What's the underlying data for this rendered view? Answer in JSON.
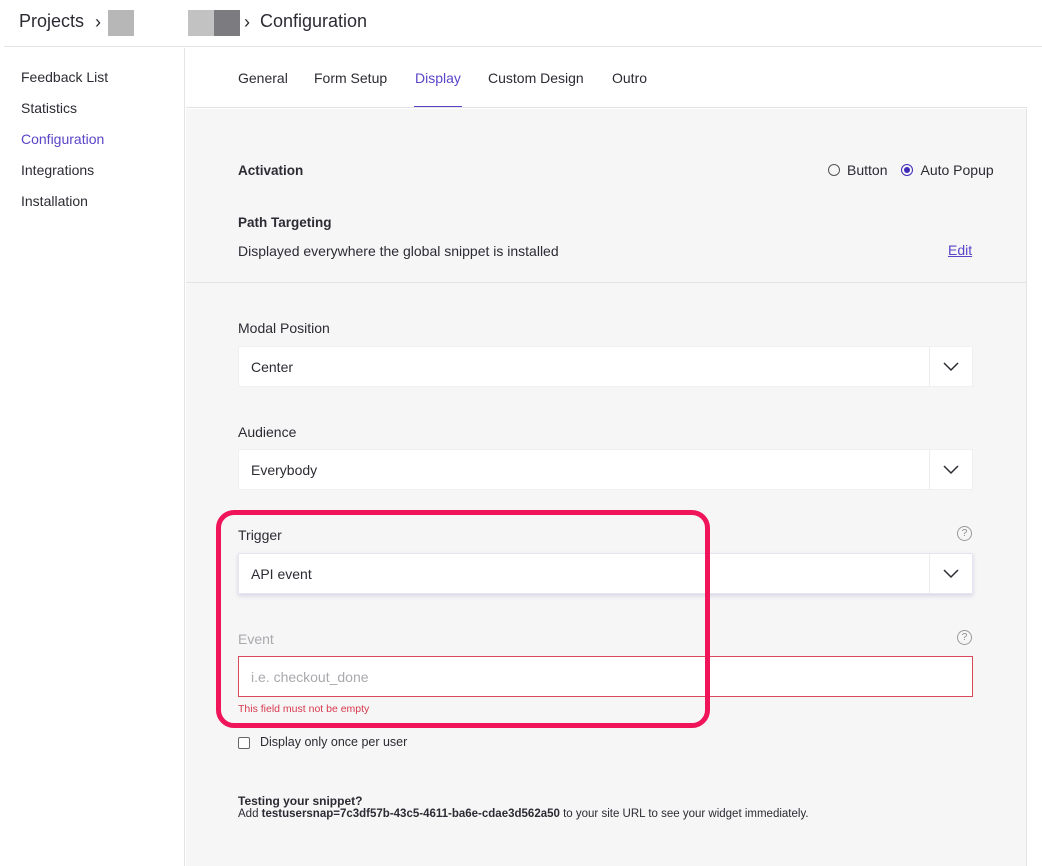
{
  "breadcrumb": {
    "projects": "Projects",
    "separator": "›",
    "current": "Configuration"
  },
  "sidebar": {
    "items": [
      {
        "label": "Feedback List",
        "active": false
      },
      {
        "label": "Statistics",
        "active": false
      },
      {
        "label": "Configuration",
        "active": true
      },
      {
        "label": "Integrations",
        "active": false
      },
      {
        "label": "Installation",
        "active": false
      }
    ]
  },
  "tabs": [
    {
      "label": "General",
      "active": false
    },
    {
      "label": "Form Setup",
      "active": false
    },
    {
      "label": "Display",
      "active": true
    },
    {
      "label": "Custom Design",
      "active": false
    },
    {
      "label": "Outro",
      "active": false
    }
  ],
  "activation": {
    "label": "Activation",
    "options": [
      {
        "label": "Button",
        "selected": false
      },
      {
        "label": "Auto Popup",
        "selected": true
      }
    ]
  },
  "path_targeting": {
    "label": "Path Targeting",
    "description": "Displayed everywhere the global snippet is installed",
    "edit_label": "Edit"
  },
  "modal_position": {
    "label": "Modal Position",
    "value": "Center"
  },
  "audience": {
    "label": "Audience",
    "value": "Everybody"
  },
  "trigger": {
    "label": "Trigger",
    "value": "API event",
    "help": "?"
  },
  "event": {
    "label": "Event",
    "placeholder": "i.e. checkout_done",
    "value": "",
    "help": "?",
    "error": "This field must not be empty"
  },
  "display_once": {
    "label": "Display only once per user",
    "checked": false
  },
  "testing": {
    "title": "Testing your snippet?",
    "prefix": "Add ",
    "param": "testusersnap=7c3df57b-43c5-4611-ba6e-cdae3d562a50",
    "suffix": " to your site URL to see your widget immediately."
  },
  "colors": {
    "accent": "#5a45c8",
    "error": "#d8394e",
    "highlight": "#f0145a"
  }
}
